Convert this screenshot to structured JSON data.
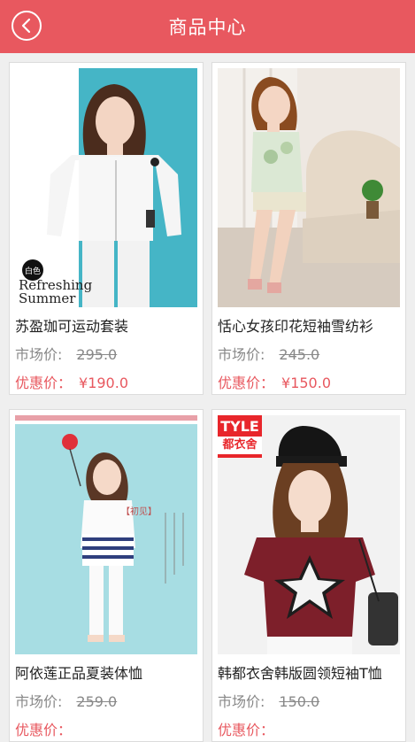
{
  "header": {
    "title": "商品中心",
    "back_icon": "chevron-left-icon",
    "color": "#e8585f"
  },
  "labels": {
    "market": "市场价:",
    "deal": "优惠价："
  },
  "products": [
    {
      "name": "苏盈珈可运动套装",
      "market_price": "295.0",
      "deal_price": "¥190.0",
      "tag": "白色",
      "caption_line1": "Refreshing",
      "caption_line2": "Summer"
    },
    {
      "name": "恬心女孩印花短袖雪纺衫",
      "market_price": "245.0",
      "deal_price": "¥150.0"
    },
    {
      "name": "阿依莲正品夏装体恤",
      "market_price": "259.0",
      "deal_price": "",
      "tag": "【初见】"
    },
    {
      "name": "韩都衣舍韩版圆领短袖T恤",
      "market_price": "150.0",
      "deal_price": "",
      "badge_line1": "TYLE",
      "badge_line2": "都衣舍"
    }
  ]
}
